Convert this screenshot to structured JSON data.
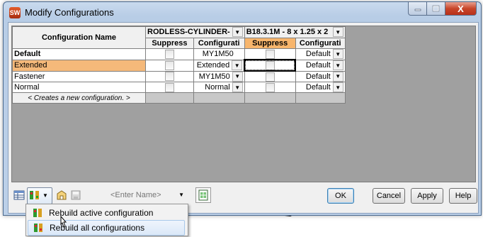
{
  "window": {
    "title": "Modify Configurations",
    "close_glyph": "X"
  },
  "table": {
    "header_config_name": "Configuration Name",
    "feature1_name": "RODLESS-CYLINDER-",
    "feature2_name": "B18.3.1M - 8 x 1.25 x 2",
    "sub_suppress": "Suppress",
    "sub_configuration": "Configurati",
    "rows": [
      {
        "name": "Default",
        "f1_cfg": "MY1M50",
        "f2_cfg": "Default"
      },
      {
        "name": "Extended",
        "f1_cfg": "Extended",
        "f2_cfg": "Default"
      },
      {
        "name": "Fastener",
        "f1_cfg": "MY1M50",
        "f2_cfg": "Default"
      },
      {
        "name": "Normal",
        "f1_cfg": "Normal",
        "f2_cfg": "Default"
      }
    ],
    "create_row": "< Creates a new configuration. >"
  },
  "toolbar": {
    "name_placeholder": "<Enter Name>"
  },
  "buttons": {
    "ok": "OK",
    "cancel": "Cancel",
    "apply": "Apply",
    "help": "Help"
  },
  "menu": {
    "items": [
      {
        "label": "Rebuild active configuration"
      },
      {
        "label": "Rebuild all configurations"
      }
    ]
  },
  "colors": {
    "selected_row": "#f5b97a",
    "selected_header": "#f7b56c",
    "title_bar": "#c9daee",
    "close_button": "#c8462a"
  }
}
